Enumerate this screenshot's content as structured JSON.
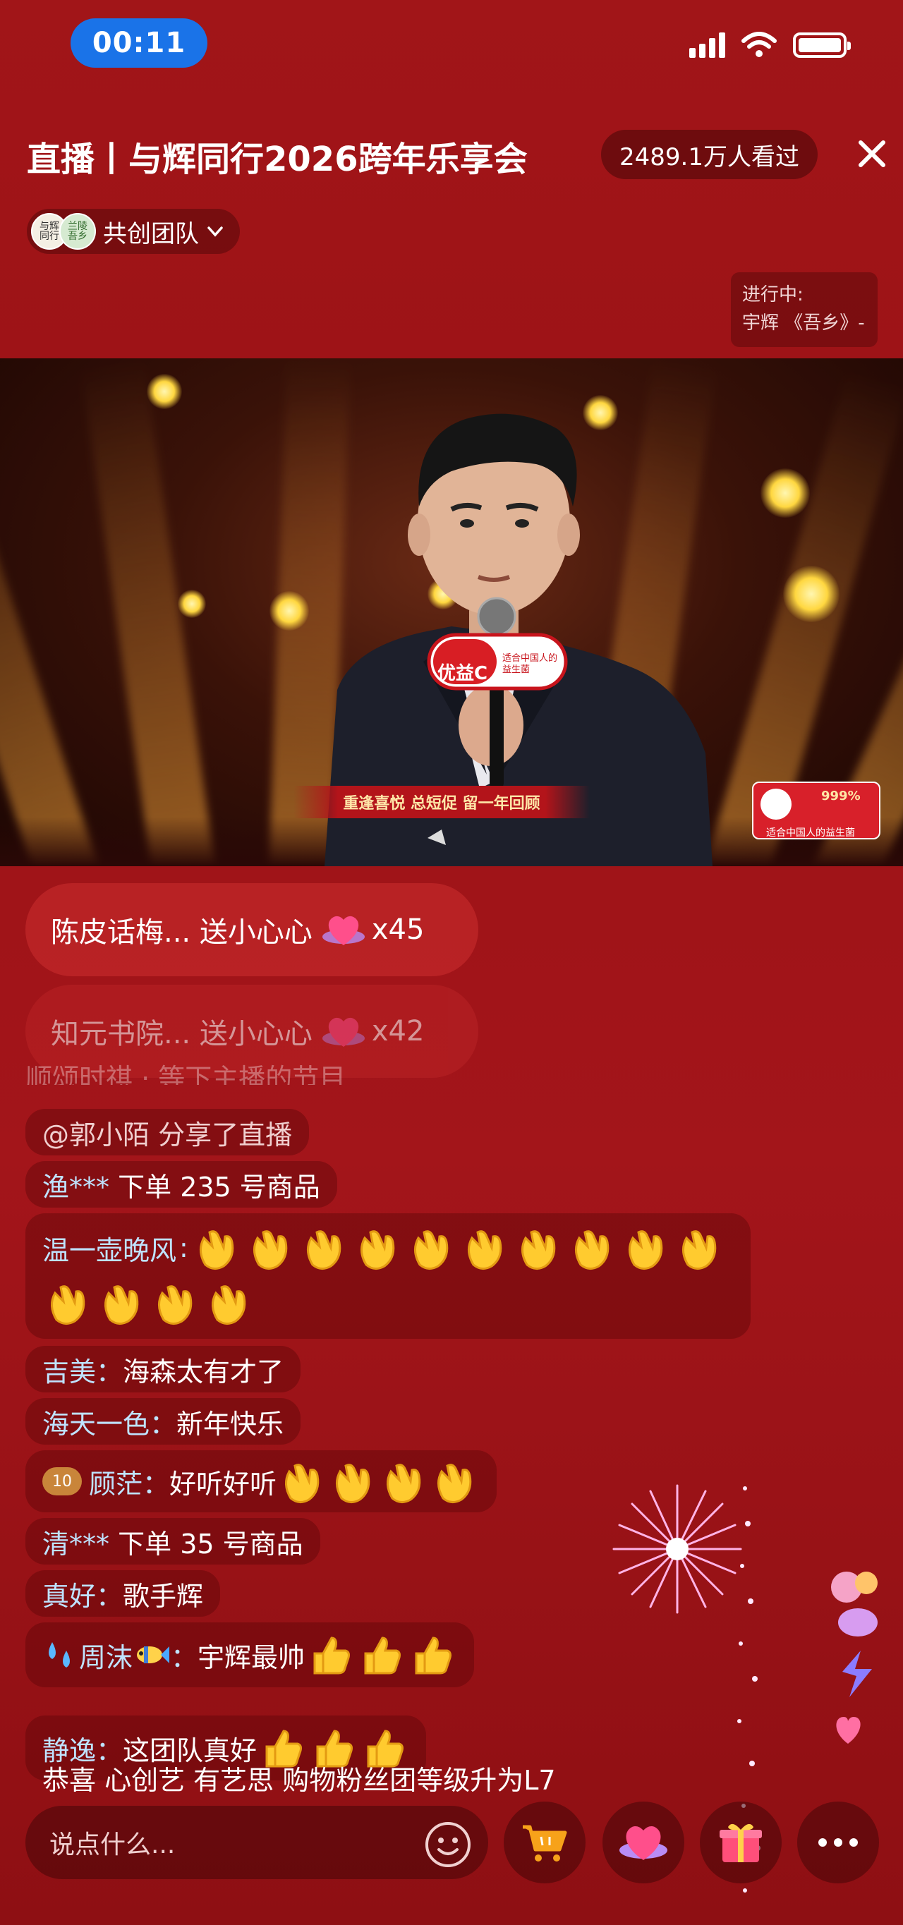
{
  "status_bar": {
    "time": "00:11"
  },
  "header": {
    "title": "直播丨与辉同行2026跨年乐享会",
    "viewers": "2489.1万人看过",
    "team_label": "共创团队",
    "now_playing_label": "进行中:",
    "now_playing_song": "宇辉 《吾乡》-"
  },
  "video": {
    "badge_brand": "优益C",
    "badge_slogan": "适合中国人的益生菌",
    "caption": "重逢喜悦 总短促 留一年回顾",
    "ad_caption": "适合中国人的益生菌",
    "ad_badge": "999%"
  },
  "gifts": [
    {
      "user": "陈皮话梅...",
      "action": "送小心心",
      "count": "x45"
    },
    {
      "user": "知元书院...",
      "action": "送小心心",
      "count": "x42"
    }
  ],
  "chat": {
    "ghost_line": "顺颂时祺 · 等下主播的节目",
    "share": "@郭小陌 分享了直播",
    "order1_user": "渔***",
    "order1_text": "下单 235 号商品",
    "clap_user": "温一壶晚风",
    "jimei_user": "吉美",
    "jimei_text": "海森太有才了",
    "haitian_user": "海天一色",
    "haitian_text": "新年快乐",
    "badge_level": "10",
    "gumang_user": "顾茫",
    "gumang_text": "好听好听",
    "order2_user": "清***",
    "order2_text": "下单 35 号商品",
    "zhenhao_user": "真好",
    "zhenhao_text": "歌手辉",
    "zhoumo_user": "周沫",
    "zhoumo_text": "宇辉最帅",
    "jingyi_user": "静逸",
    "jingyi_text": "这团队真好",
    "level_line": "恭喜 心创艺 有艺思 购物粉丝团等级升为L7"
  },
  "bottom_bar": {
    "input_placeholder": "说点什么..."
  },
  "icons": {
    "close": "close-icon",
    "emoji": "smiley-icon",
    "cart": "cart-icon",
    "heart": "heart-gift-icon",
    "gift": "gift-box-icon",
    "more": "more-icon"
  },
  "colors": {
    "background": "#a11518",
    "time_pill": "#1a73e8",
    "username": "#bfe3ff",
    "cart": "#f7a21a",
    "gift": "#ff4f7a"
  }
}
